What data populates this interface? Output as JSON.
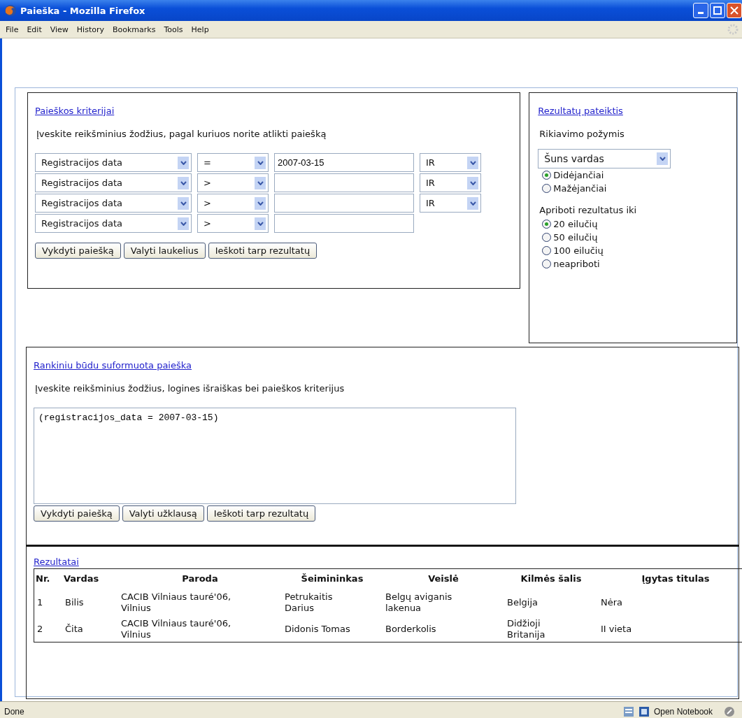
{
  "window": {
    "title": "Paieška - Mozilla Firefox"
  },
  "menu": [
    "File",
    "Edit",
    "View",
    "History",
    "Bookmarks",
    "Tools",
    "Help"
  ],
  "criteria": {
    "title": "Paieškos kriterijai",
    "instruction": "Įveskite reikšminius žodžius, pagal kuriuos norite atlikti paiešką",
    "rows": [
      {
        "field": "Registracijos data",
        "operator": "=",
        "value": "2007-03-15",
        "connector": "IR"
      },
      {
        "field": "Registracijos data",
        "operator": ">",
        "connector": "IR"
      },
      {
        "field": "Registracijos data",
        "operator": ">",
        "connector": "IR"
      },
      {
        "field": "Registracijos data",
        "operator": ">"
      }
    ],
    "buttons": [
      "Vykdyti paiešką",
      "Valyti laukelius",
      "Ieškoti tarp rezultatų"
    ]
  },
  "presentation": {
    "title": "Rezultatų pateiktis",
    "sort_label": "Rikiavimo požymis",
    "sort_field": "Šuns vardas",
    "order": [
      {
        "label": "Didėjančiai",
        "selected": true
      },
      {
        "label": "Mažėjančiai",
        "selected": false
      }
    ],
    "limit_label": "Apriboti rezultatus iki",
    "limits": [
      {
        "label": "20 eilučių",
        "selected": true
      },
      {
        "label": "50 eilučių",
        "selected": false
      },
      {
        "label": "100 eilučių",
        "selected": false
      },
      {
        "label": "neapriboti",
        "selected": false
      }
    ]
  },
  "manual": {
    "title": "Rankiniu būdu suformuota paieška",
    "instruction": "Įveskite reikšminius žodžius, logines išraiškas bei paieškos kriterijus",
    "query": "(registracijos_data = 2007-03-15)",
    "buttons": [
      "Vykdyti paiešką",
      "Valyti užklausą",
      "Ieškoti tarp rezultatų"
    ]
  },
  "results": {
    "title": "Rezultatai",
    "columns": [
      "Nr.",
      "Vardas",
      "Paroda",
      "Šeimininkas",
      "Veislė",
      "Kilmės šalis",
      "Įgytas titulas"
    ],
    "rows": [
      [
        "1",
        "Bilis",
        "CACIB Vilniaus tauré'06, Vilnius",
        "Petrukaitis Darius",
        "Belgų aviganis lakenua",
        "Belgija",
        "Nėra"
      ],
      [
        "2",
        "Čita",
        "CACIB Vilniaus tauré'06, Vilnius",
        "Didonis Tomas",
        "Borderkolis",
        "Didžioji Britanija",
        "II vieta"
      ]
    ]
  },
  "status_bar": {
    "text": "Done",
    "notebook": "Open Notebook"
  }
}
